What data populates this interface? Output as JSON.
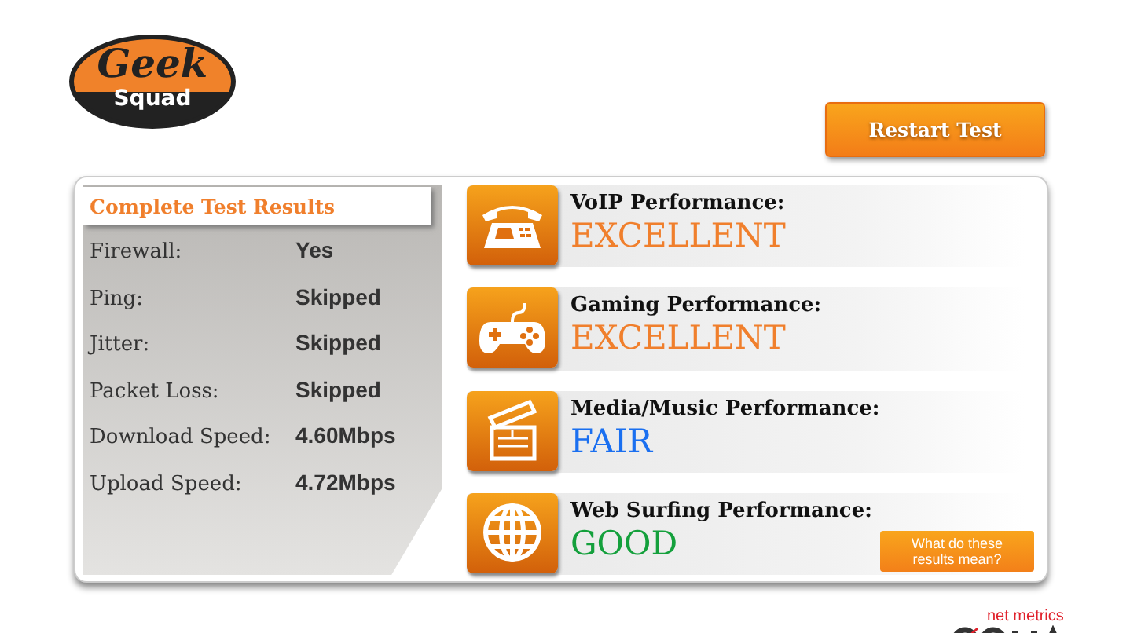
{
  "logo": {
    "line_1": "Geek",
    "line_2": "Squad"
  },
  "restart_button": "Restart Test",
  "results": {
    "title": "Complete Test Results",
    "rows": [
      {
        "label": "Firewall:",
        "value": "Yes"
      },
      {
        "label": "Ping:",
        "value": "Skipped"
      },
      {
        "label": "Jitter:",
        "value": "Skipped"
      },
      {
        "label": "Packet Loss:",
        "value": "Skipped"
      },
      {
        "label": "Download Speed:",
        "value": "4.60Mbps"
      },
      {
        "label": "Upload Speed:",
        "value": "4.72Mbps"
      }
    ]
  },
  "performance": [
    {
      "kind": "phone",
      "title": "VoIP Performance:",
      "rating": "EXCELLENT",
      "color": "#f07f2c"
    },
    {
      "kind": "gamepad",
      "title": "Gaming Performance:",
      "rating": "EXCELLENT",
      "color": "#f07f2c"
    },
    {
      "kind": "clapper",
      "title": "Media/Music Performance:",
      "rating": "FAIR",
      "color": "#1a6ff0"
    },
    {
      "kind": "globe",
      "title": "Web Surfing Performance:",
      "rating": "GOOD",
      "color": "#14a03c"
    }
  ],
  "help_button": "What do these results mean?",
  "footer_logo": {
    "tagline": "net metrics"
  }
}
